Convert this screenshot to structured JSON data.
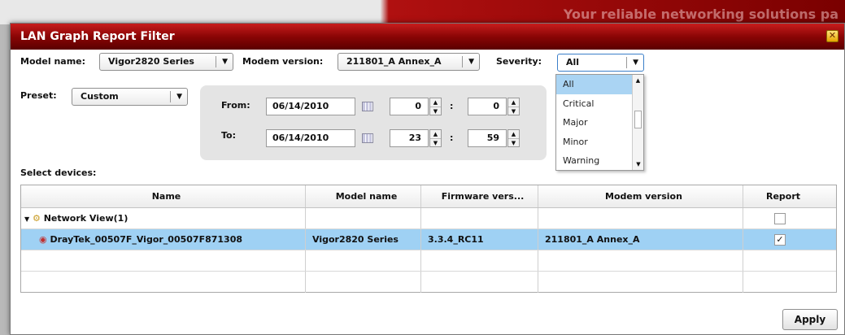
{
  "background": {
    "slogan": "Your reliable networking solutions pa"
  },
  "dialog": {
    "title": "LAN Graph Report Filter",
    "close_icon": "close-icon"
  },
  "filters": {
    "model_label": "Model name:",
    "model_value": "Vigor2820 Series",
    "modem_label": "Modem version:",
    "modem_value": "211801_A Annex_A",
    "severity_label": "Severity:",
    "severity_value": "All",
    "preset_label": "Preset:",
    "preset_value": "Custom"
  },
  "range": {
    "from_label": "From:",
    "from_date": "06/14/2010",
    "from_hour": "0",
    "from_min": "0",
    "to_label": "To:",
    "to_date": "06/14/2010",
    "to_hour": "23",
    "to_min": "59",
    "colon": ":"
  },
  "severity_options": [
    "All",
    "Critical",
    "Major",
    "Minor",
    "Warning"
  ],
  "devices": {
    "label": "Select devices:",
    "columns": [
      "Name",
      "Model name",
      "Firmware vers...",
      "Modem version",
      "Report"
    ],
    "rows": [
      {
        "name": "Network View(1)",
        "model": "",
        "firmware": "",
        "modem": "",
        "report": "",
        "checked": false
      },
      {
        "name": "DrayTek_00507F_Vigor_00507F871308",
        "model": "Vigor2820 Series",
        "firmware": "3.3.4_RC11",
        "modem": "211801_A Annex_A",
        "report": "✓",
        "checked": true
      }
    ]
  },
  "apply_label": "Apply",
  "colors": {
    "title_red": "#8a0505",
    "selection": "#9fd1f4"
  }
}
